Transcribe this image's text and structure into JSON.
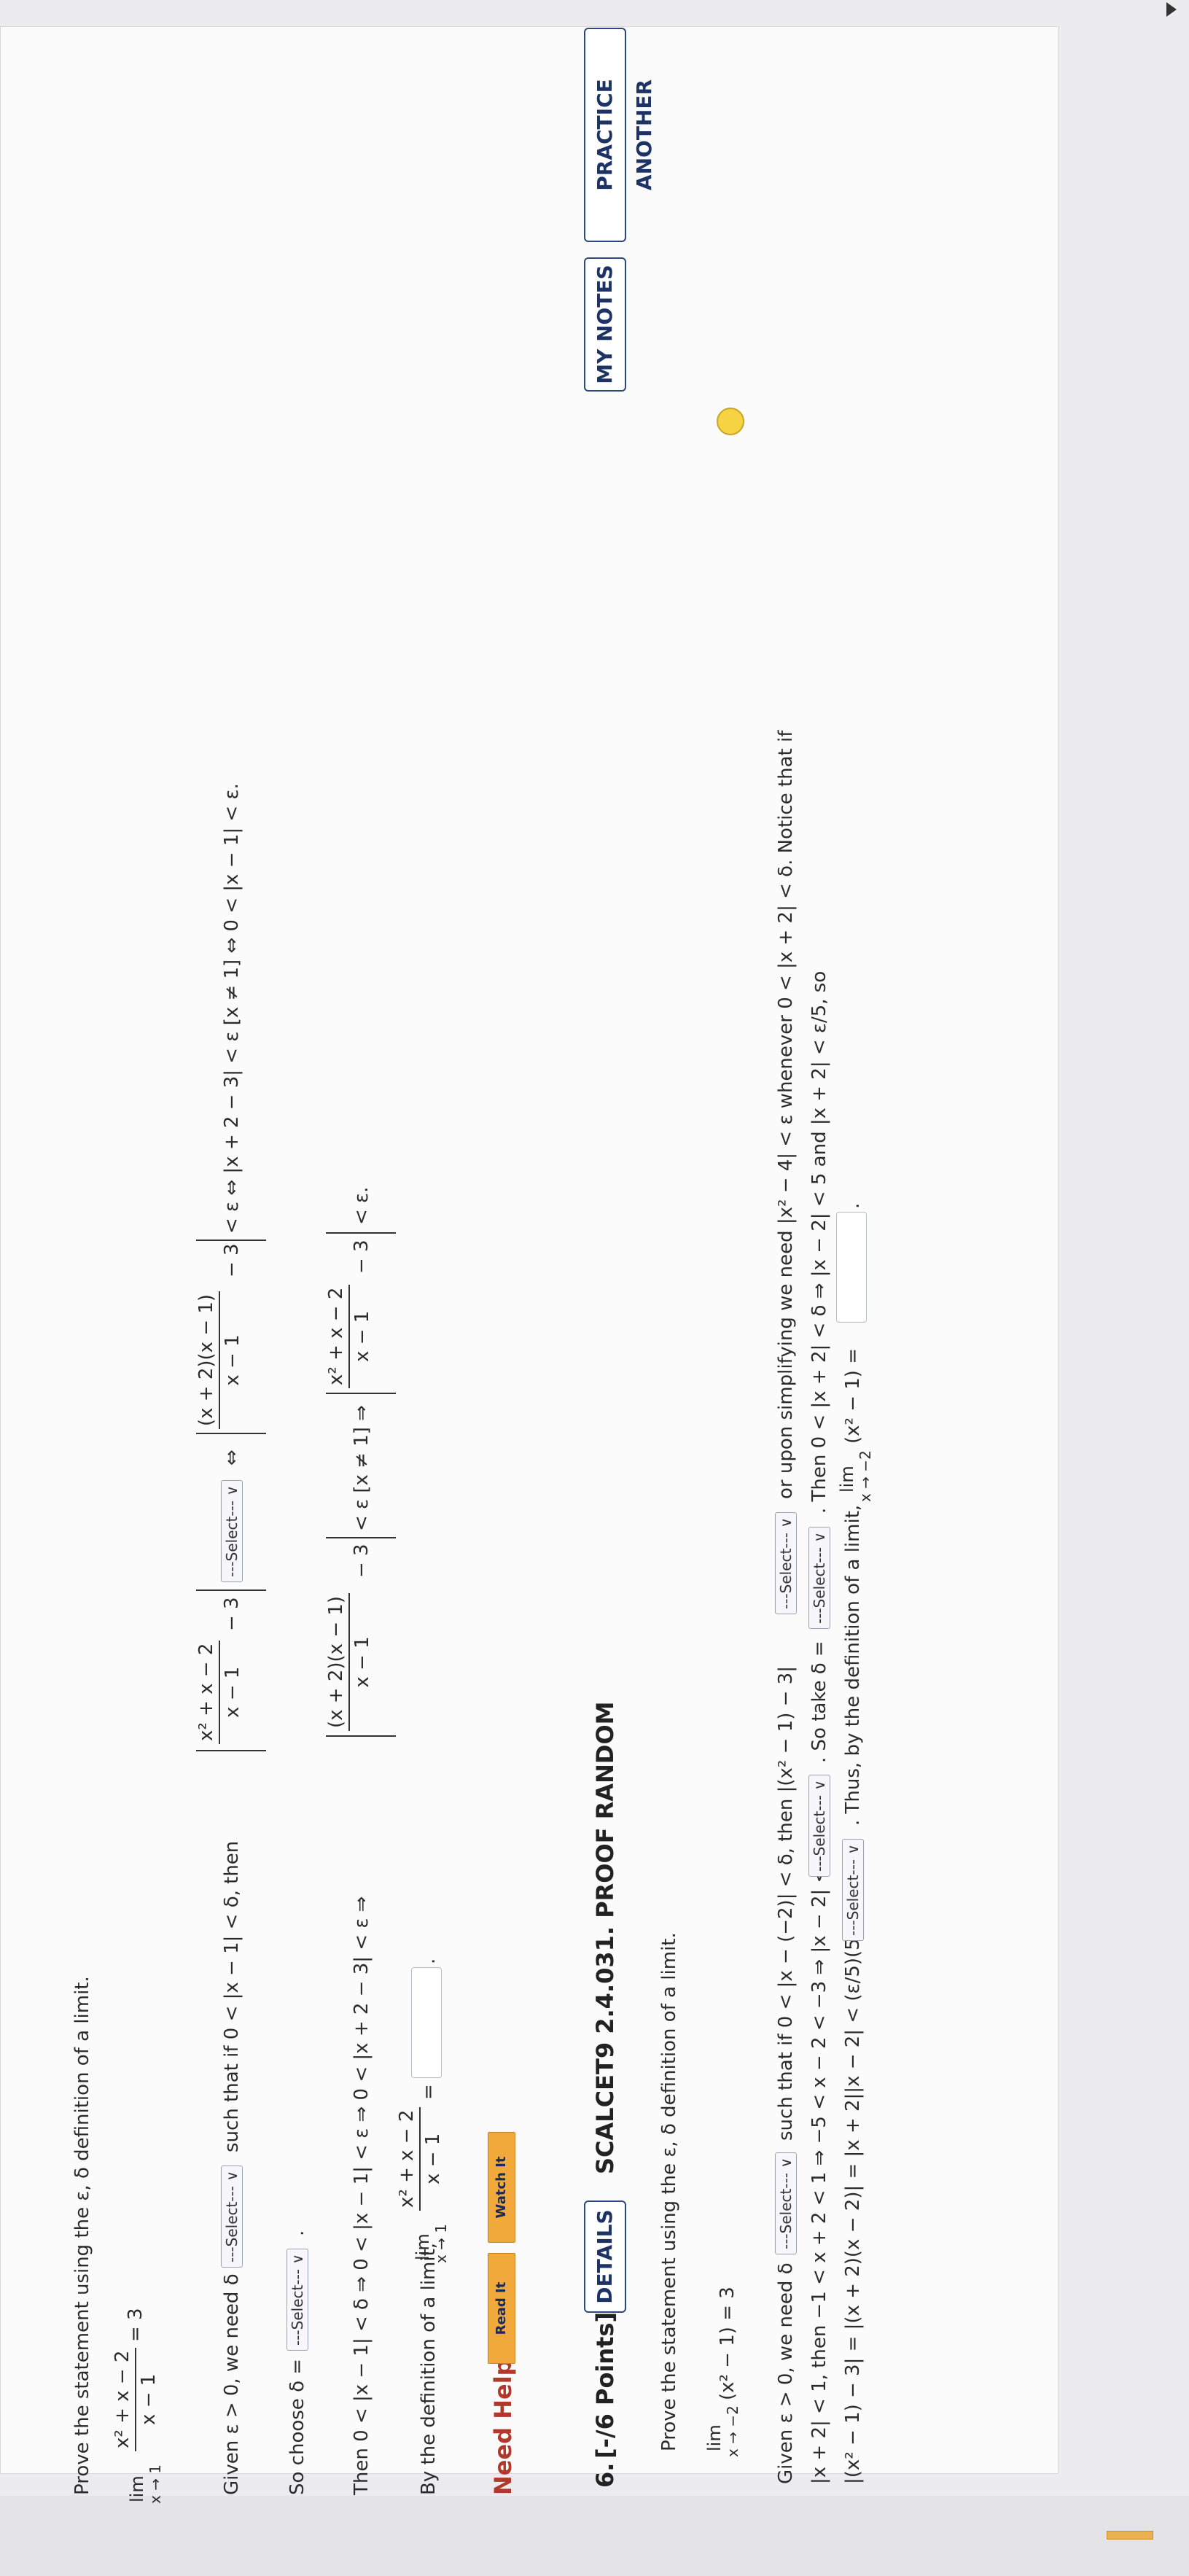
{
  "q5": {
    "prompt": "Prove the statement using the ε, δ definition of a limit.",
    "lim_word": "lim",
    "lim_sub": "x → 1",
    "num1": "x² + x − 2",
    "den1": "x − 1",
    "eq3": "= 3",
    "given_start": "Given ε > 0, we need δ",
    "given_mid": "such that if 0 < |x − 1| < δ, then",
    "minus3": "− 3",
    "iff1": "⇔",
    "num2": "(x + 2)(x − 1)",
    "den2": "x − 1",
    "tail1": "< ε ⇔ |x + 2 − 3| < ε [x ≠ 1] ⇔ 0 < |x − 1| < ε.",
    "so_choose": "So choose δ =",
    "so_dot": ".",
    "then_chain": "Then 0 < |x − 1| < δ ⇒ 0 < |x − 1| < ε ⇒ 0 < |x + 2 − 3| < ε ⇒",
    "then_mid": "− 3",
    "then_mid2": "< ε [x ≠ 1] ⇒",
    "then_tail": "− 3",
    "then_end": "< ε.",
    "by_def": "By the definition of a limit,",
    "by_eq": "=",
    "by_dot": "."
  },
  "select_label": "---Select---",
  "help": {
    "label": "Need Help?",
    "read": "Read It",
    "watch": "Watch It"
  },
  "q6": {
    "number": "6.",
    "points": "[-/6 Points]",
    "details": "DETAILS",
    "code": "SCALCET9 2.4.031. PROOF RANDOM",
    "my_notes": "MY NOTES",
    "practice": "PRACTICE ANOTHER",
    "prompt": "Prove the statement using the ε, δ definition of a limit.",
    "lim_word": "lim",
    "lim_sub": "x → −2",
    "expr": "(x² − 1) = 3",
    "l1a": "Given ε > 0, we need δ",
    "l1b": "such that if 0 < |x − (−2)| < δ, then |(x² − 1) − 3|",
    "l1c": "or upon simplifying we need |x² − 4| < ε whenever 0 < |x + 2| < δ. Notice that if",
    "l2a": "|x + 2| < 1, then −1 < x + 2 < 1 ⇒ −5 < x − 2 < −3 ⇒ |x − 2| <",
    "l2b": ". So take δ =",
    "l2c": ". Then 0 < |x + 2| < δ ⇒ |x − 2| < 5 and |x + 2| < ε/5, so",
    "l3a": "|(x² − 1) − 3| = |(x + 2)(x − 2)| = |x + 2||x − 2| < (ε/5)(5) =",
    "l3b": ". Thus, by the definition of a limit,",
    "l3c": "(x² − 1) =",
    "l3d": "."
  }
}
